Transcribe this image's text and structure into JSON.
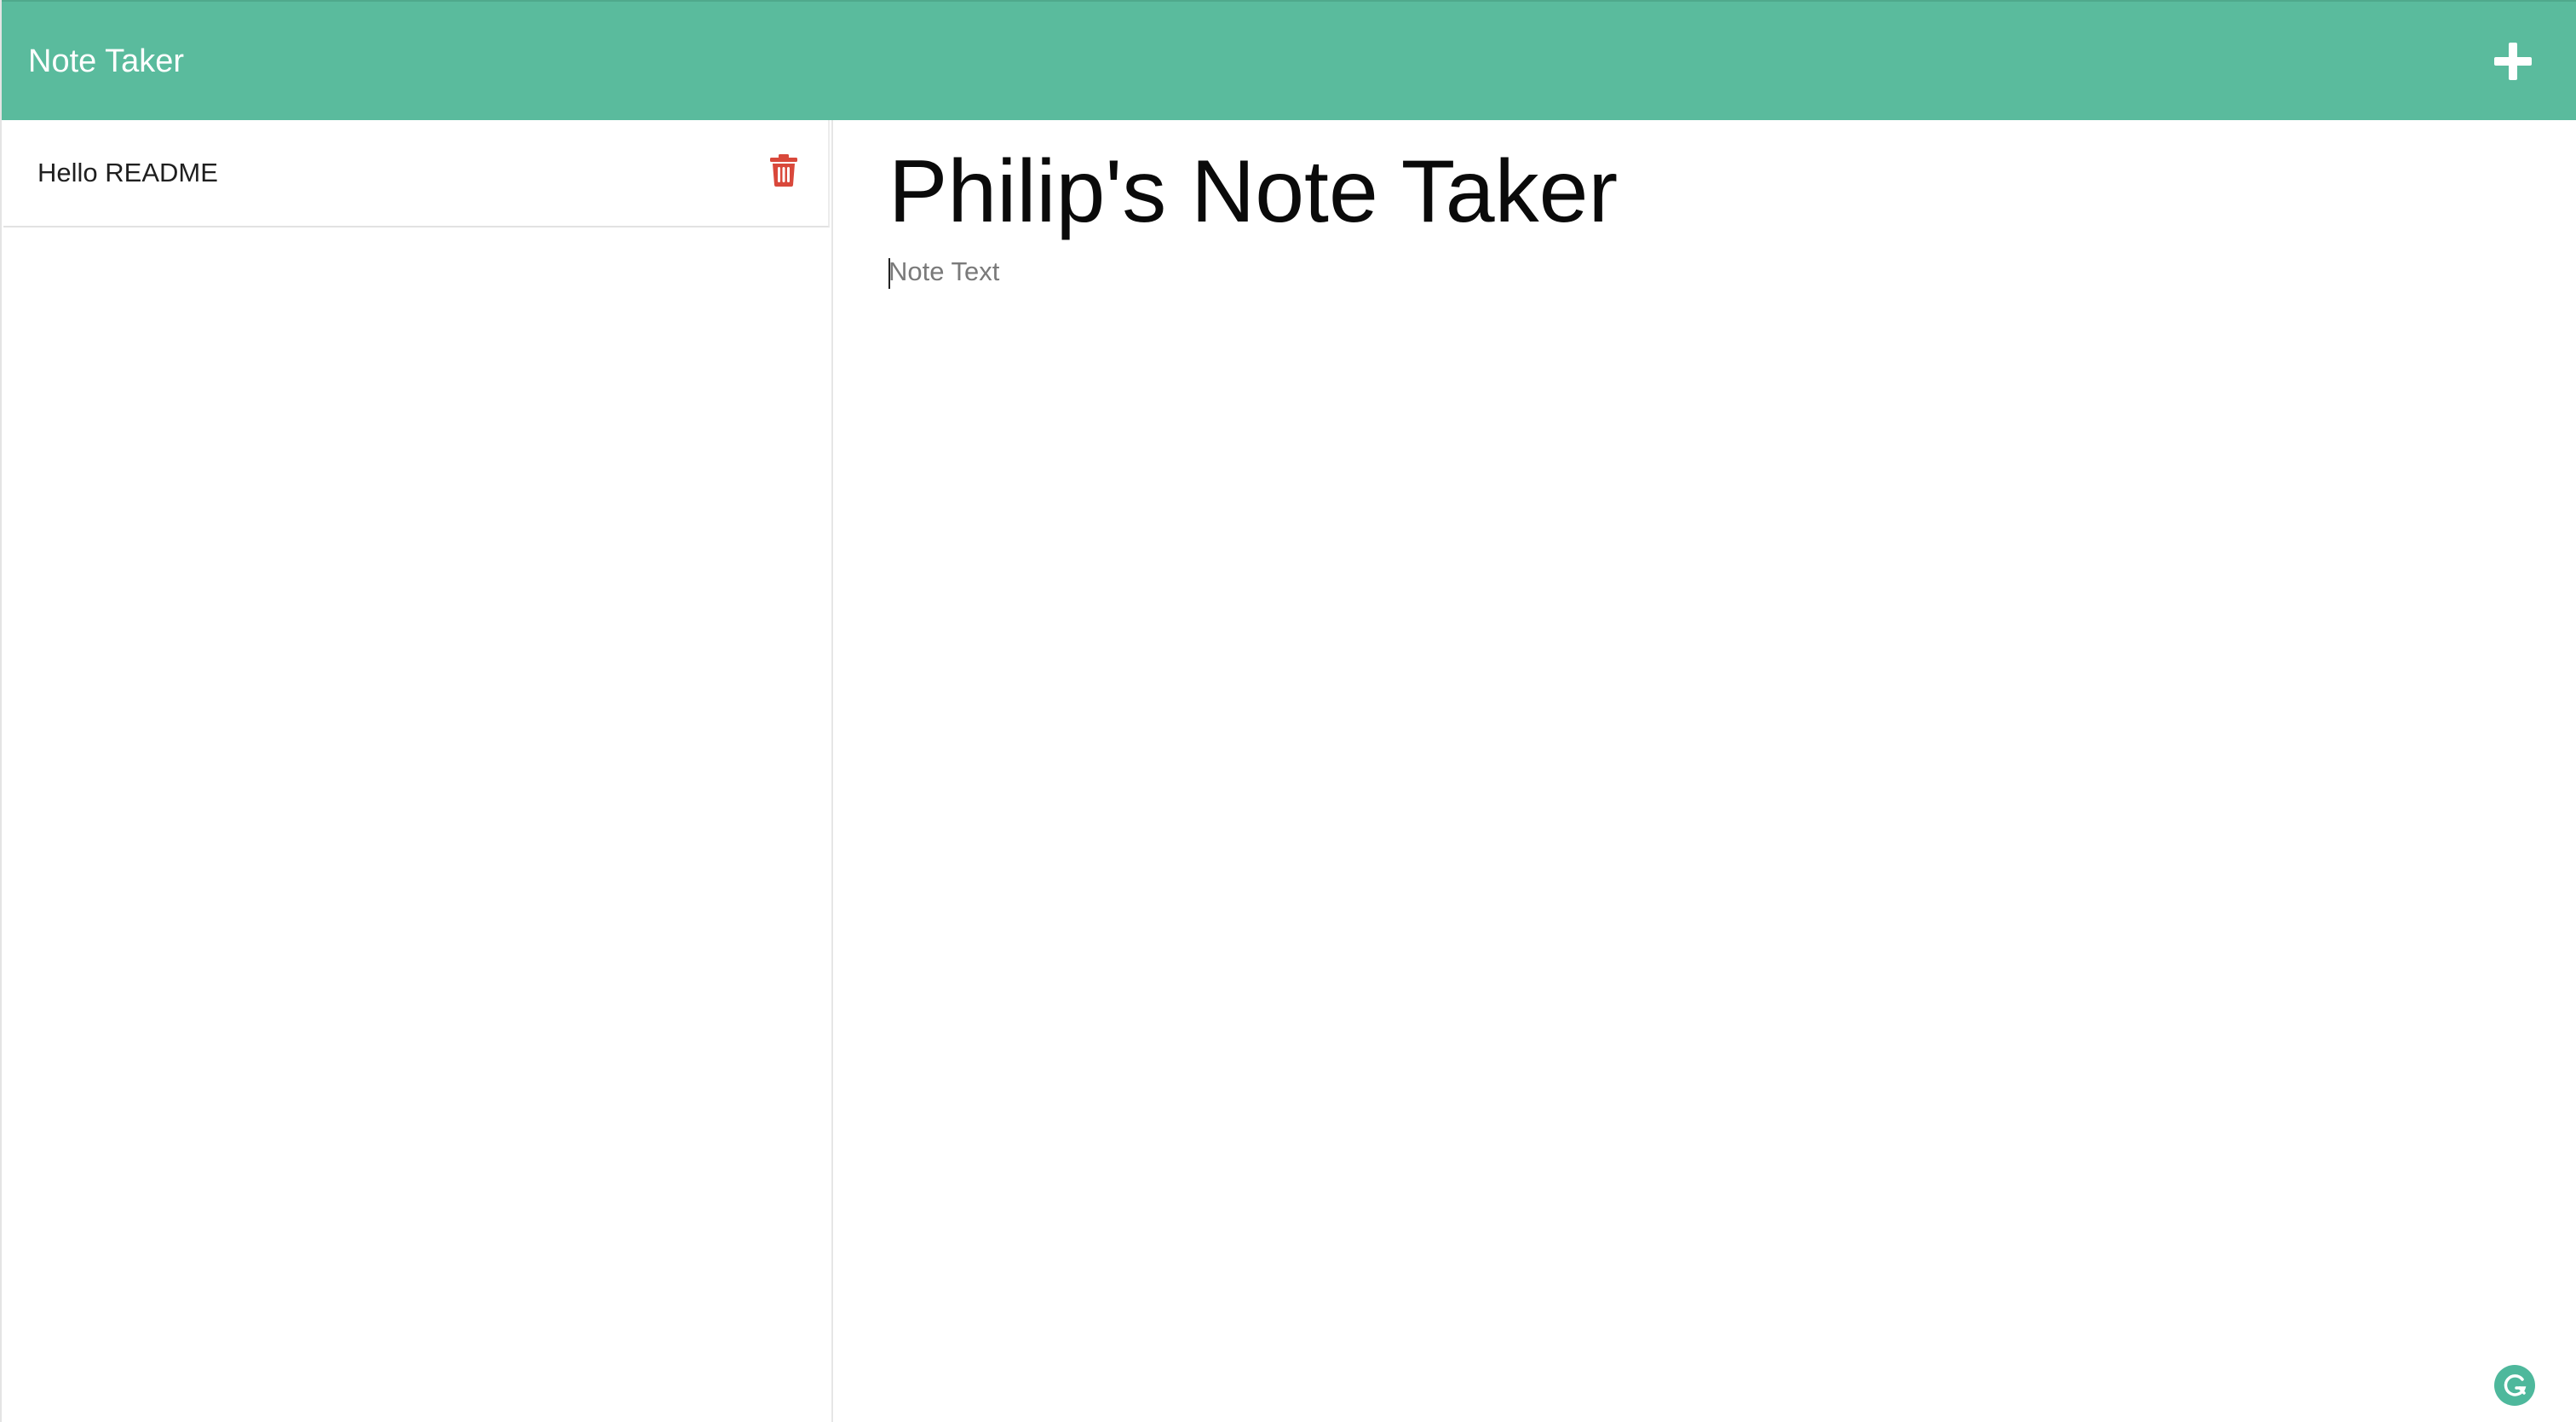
{
  "navbar": {
    "brand": "Note Taker",
    "add_icon": "plus-icon",
    "background_color": "#5abb9d"
  },
  "sidebar": {
    "notes": [
      {
        "title": "Hello README",
        "delete_icon": "trash-icon"
      }
    ]
  },
  "editor": {
    "title_value": "Philip's Note Taker",
    "text_placeholder": "Note Text",
    "text_value": ""
  },
  "extension": {
    "icon": "grammarly-icon",
    "color": "#4eb89c"
  },
  "colors": {
    "delete": "#d9483b"
  }
}
